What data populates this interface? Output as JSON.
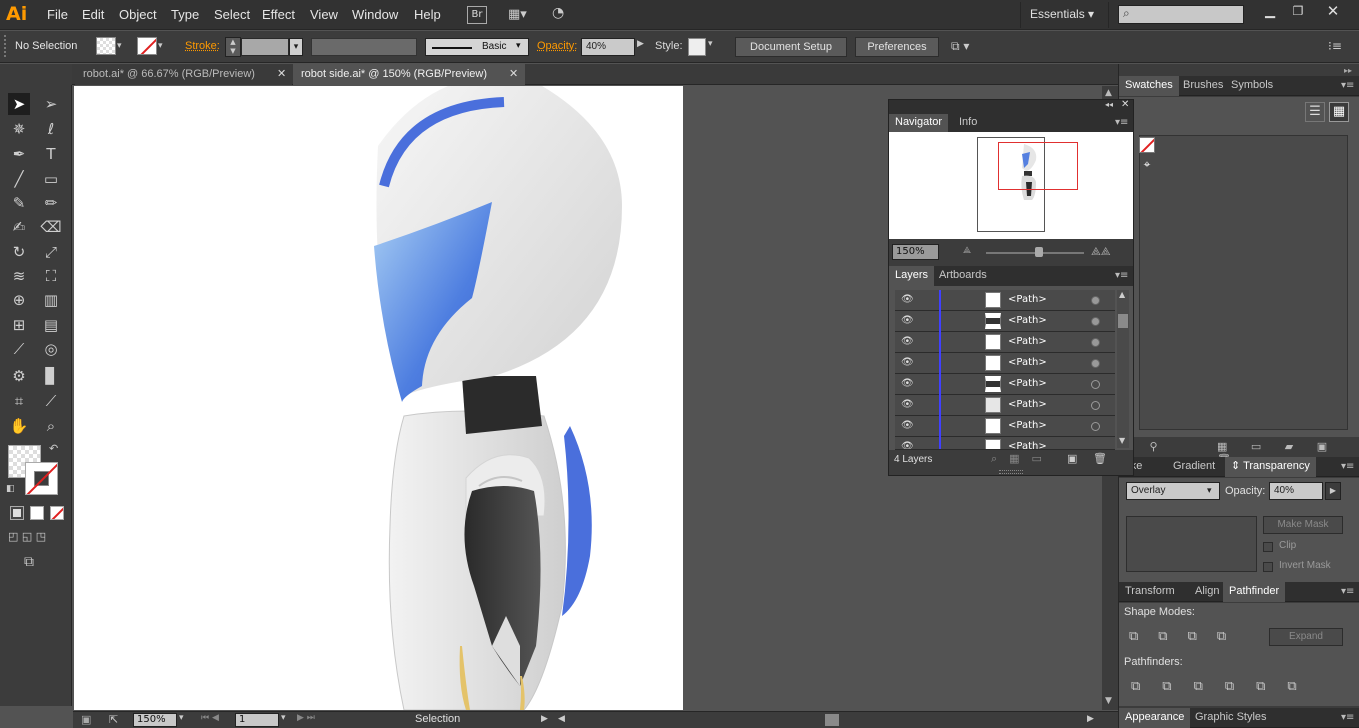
{
  "app": {
    "logo": "Ai"
  },
  "menu": [
    "File",
    "Edit",
    "Object",
    "Type",
    "Select",
    "Effect",
    "View",
    "Window",
    "Help"
  ],
  "br_badge": "Br",
  "workspace": "Essentials",
  "control": {
    "selection": "No Selection",
    "stroke_label": "Stroke:",
    "stroke_style": "Basic",
    "opacity_label": "Opacity:",
    "opacity_value": "40%",
    "style_label": "Style:",
    "doc_setup": "Document Setup",
    "preferences": "Preferences"
  },
  "tabs": [
    {
      "label": "robot.ai* @ 66.67% (RGB/Preview)",
      "active": false
    },
    {
      "label": "robot side.ai* @ 150% (RGB/Preview)",
      "active": true
    }
  ],
  "status": {
    "zoom": "150%",
    "artboard": "1",
    "tool": "Selection"
  },
  "navigator": {
    "tabs": [
      "Navigator",
      "Info"
    ],
    "zoom": "150%"
  },
  "layers": {
    "tabs": [
      "Layers",
      "Artboards"
    ],
    "rows": [
      "<Path>",
      "<Path>",
      "<Path>",
      "<Path>",
      "<Path>",
      "<Path>",
      "<Path>",
      "<Path>"
    ],
    "count": "4 Layers"
  },
  "swatches": {
    "tabs": [
      "Swatches",
      "Brushes",
      "Symbols"
    ]
  },
  "transparency": {
    "tabs": [
      "roke",
      "Gradient",
      "Transparency"
    ],
    "mode": "Overlay",
    "opacity_label": "Opacity:",
    "opacity_value": "40%",
    "make_mask": "Make Mask",
    "clip": "Clip",
    "invert": "Invert Mask"
  },
  "pathfinder": {
    "tabs": [
      "Transform",
      "Align",
      "Pathfinder"
    ],
    "shape_modes": "Shape Modes:",
    "expand": "Expand",
    "pathfinders": "Pathfinders:"
  },
  "appearance": {
    "tabs": [
      "Appearance",
      "Graphic Styles"
    ]
  },
  "colors": {
    "accent": "#ff9a00",
    "selection_blue": "#4040ff",
    "nav_frame": "#e03030"
  }
}
